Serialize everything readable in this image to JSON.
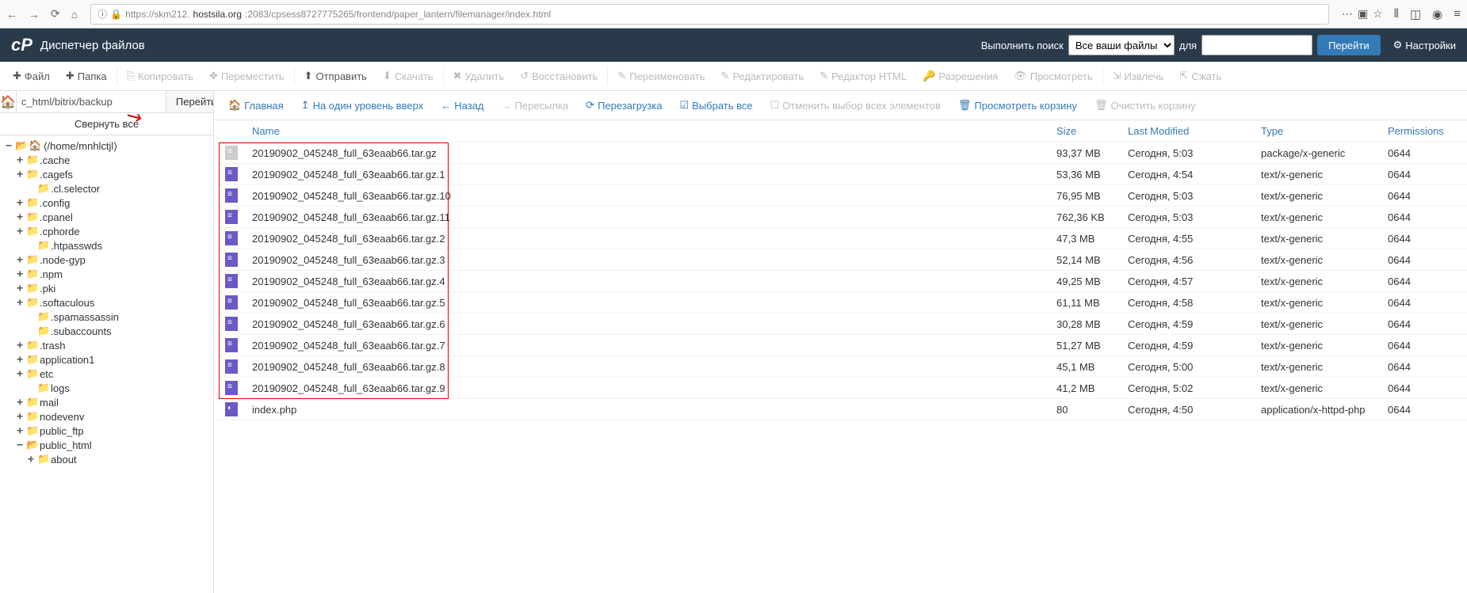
{
  "browser": {
    "url_prefix": "https://skm212.",
    "url_host": "hostsila.org",
    "url_suffix": ":2083/cpsess8727775265/frontend/paper_lantern/filemanager/index.html"
  },
  "header": {
    "app_title": "Диспетчер файлов",
    "search_label": "Выполнить поиск",
    "search_scope": "Все ваши файлы",
    "search_for": "для",
    "go_label": "Перейти",
    "settings_label": "Настройки"
  },
  "toolbar": {
    "file": "Файл",
    "folder": "Папка",
    "copy": "Копировать",
    "move": "Переместить",
    "upload": "Отправить",
    "download": "Скачать",
    "delete": "Удалить",
    "restore": "Восстановить",
    "rename": "Переименовать",
    "edit": "Редактировать",
    "html_editor": "Редактор HTML",
    "permissions": "Разрешения",
    "view": "Просмотреть",
    "extract": "Извлечь",
    "compress": "Сжать"
  },
  "left": {
    "path_value": "c_html/bitrix/backup",
    "go": "Перейти",
    "collapse": "Свернуть все",
    "root": "(/home/mnhlctjl)",
    "tree": [
      {
        "depth": 1,
        "toggle": "+",
        "label": ".cache"
      },
      {
        "depth": 1,
        "toggle": "+",
        "label": ".cagefs"
      },
      {
        "depth": 2,
        "toggle": "",
        "label": ".cl.selector"
      },
      {
        "depth": 1,
        "toggle": "+",
        "label": ".config"
      },
      {
        "depth": 1,
        "toggle": "+",
        "label": ".cpanel"
      },
      {
        "depth": 1,
        "toggle": "+",
        "label": ".cphorde"
      },
      {
        "depth": 2,
        "toggle": "",
        "label": ".htpasswds"
      },
      {
        "depth": 1,
        "toggle": "+",
        "label": ".node-gyp"
      },
      {
        "depth": 1,
        "toggle": "+",
        "label": ".npm"
      },
      {
        "depth": 1,
        "toggle": "+",
        "label": ".pki"
      },
      {
        "depth": 1,
        "toggle": "+",
        "label": ".softaculous"
      },
      {
        "depth": 2,
        "toggle": "",
        "label": ".spamassassin"
      },
      {
        "depth": 2,
        "toggle": "",
        "label": ".subaccounts"
      },
      {
        "depth": 1,
        "toggle": "+",
        "label": ".trash"
      },
      {
        "depth": 1,
        "toggle": "+",
        "label": "application1"
      },
      {
        "depth": 1,
        "toggle": "+",
        "label": "etc"
      },
      {
        "depth": 2,
        "toggle": "",
        "label": "logs"
      },
      {
        "depth": 1,
        "toggle": "+",
        "label": "mail"
      },
      {
        "depth": 1,
        "toggle": "+",
        "label": "nodevenv"
      },
      {
        "depth": 1,
        "toggle": "+",
        "label": "public_ftp"
      },
      {
        "depth": 1,
        "toggle": "−",
        "label": "public_html",
        "open": true
      },
      {
        "depth": 2,
        "toggle": "+",
        "label": "about"
      }
    ]
  },
  "actionbar": {
    "home": "Главная",
    "up": "На один уровень вверх",
    "back": "Назад",
    "forward": "Пересылка",
    "reload": "Перезагрузка",
    "select_all": "Выбрать все",
    "deselect_all": "Отменить выбор всех элементов",
    "view_trash": "Просмотреть корзину",
    "empty_trash": "Очистить корзину"
  },
  "columns": {
    "name": "Name",
    "size": "Size",
    "modified": "Last Modified",
    "type": "Type",
    "permissions": "Permissions"
  },
  "files": [
    {
      "name": "20190902_045248_full_63eaab66.tar.gz",
      "size": "93,37 MB",
      "modified": "Сегодня, 5:03",
      "type": "package/x-generic",
      "perm": "0644",
      "hl": true,
      "icon": "pkg"
    },
    {
      "name": "20190902_045248_full_63eaab66.tar.gz.1",
      "size": "53,36 MB",
      "modified": "Сегодня, 4:54",
      "type": "text/x-generic",
      "perm": "0644",
      "hl": true,
      "icon": "txt"
    },
    {
      "name": "20190902_045248_full_63eaab66.tar.gz.10",
      "size": "76,95 MB",
      "modified": "Сегодня, 5:03",
      "type": "text/x-generic",
      "perm": "0644",
      "hl": true,
      "icon": "txt"
    },
    {
      "name": "20190902_045248_full_63eaab66.tar.gz.11",
      "size": "762,36 KB",
      "modified": "Сегодня, 5:03",
      "type": "text/x-generic",
      "perm": "0644",
      "hl": true,
      "icon": "txt"
    },
    {
      "name": "20190902_045248_full_63eaab66.tar.gz.2",
      "size": "47,3 MB",
      "modified": "Сегодня, 4:55",
      "type": "text/x-generic",
      "perm": "0644",
      "hl": true,
      "icon": "txt"
    },
    {
      "name": "20190902_045248_full_63eaab66.tar.gz.3",
      "size": "52,14 MB",
      "modified": "Сегодня, 4:56",
      "type": "text/x-generic",
      "perm": "0644",
      "hl": true,
      "icon": "txt"
    },
    {
      "name": "20190902_045248_full_63eaab66.tar.gz.4",
      "size": "49,25 MB",
      "modified": "Сегодня, 4:57",
      "type": "text/x-generic",
      "perm": "0644",
      "hl": true,
      "icon": "txt"
    },
    {
      "name": "20190902_045248_full_63eaab66.tar.gz.5",
      "size": "61,11 MB",
      "modified": "Сегодня, 4:58",
      "type": "text/x-generic",
      "perm": "0644",
      "hl": true,
      "icon": "txt"
    },
    {
      "name": "20190902_045248_full_63eaab66.tar.gz.6",
      "size": "30,28 MB",
      "modified": "Сегодня, 4:59",
      "type": "text/x-generic",
      "perm": "0644",
      "hl": true,
      "icon": "txt"
    },
    {
      "name": "20190902_045248_full_63eaab66.tar.gz.7",
      "size": "51,27 MB",
      "modified": "Сегодня, 4:59",
      "type": "text/x-generic",
      "perm": "0644",
      "hl": true,
      "icon": "txt"
    },
    {
      "name": "20190902_045248_full_63eaab66.tar.gz.8",
      "size": "45,1 MB",
      "modified": "Сегодня, 5:00",
      "type": "text/x-generic",
      "perm": "0644",
      "hl": true,
      "icon": "txt"
    },
    {
      "name": "20190902_045248_full_63eaab66.tar.gz.9",
      "size": "41,2 MB",
      "modified": "Сегодня, 5:02",
      "type": "text/x-generic",
      "perm": "0644",
      "hl": true,
      "icon": "txt"
    },
    {
      "name": "index.php",
      "size": "80",
      "modified": "Сегодня, 4:50",
      "type": "application/x-httpd-php",
      "perm": "0644",
      "hl": false,
      "icon": "php"
    }
  ]
}
